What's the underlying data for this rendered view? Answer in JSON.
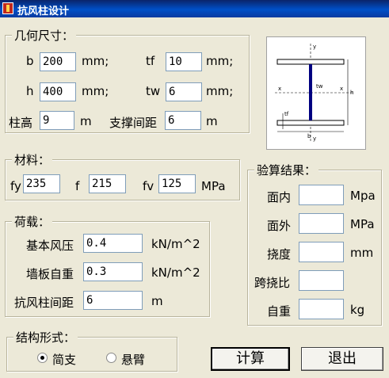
{
  "window": {
    "title": "抗风柱设计"
  },
  "geometry": {
    "legend": "几何尺寸：",
    "b": {
      "label": "b",
      "value": "200",
      "unit": "mm;"
    },
    "h": {
      "label": "h",
      "value": "400",
      "unit": "mm;"
    },
    "tf": {
      "label": "tf",
      "value": "10",
      "unit": "mm;"
    },
    "tw": {
      "label": "tw",
      "value": "6",
      "unit": "mm;"
    },
    "column_height": {
      "label": "柱高",
      "value": "9",
      "unit": "m"
    },
    "brace_spacing": {
      "label": "支撑间距",
      "value": "6",
      "unit": "m"
    }
  },
  "diagram": {
    "labels": {
      "y_top": "y",
      "y_bottom": "y",
      "x_left": "x",
      "x_right": "x",
      "b": "b",
      "h": "h",
      "tw": "tw",
      "tf": "tf"
    },
    "colors": {
      "web": "#000080",
      "flange": "#000000"
    }
  },
  "material": {
    "legend": "材料：",
    "fy": {
      "label": "fy",
      "value": "235"
    },
    "f": {
      "label": "f",
      "value": "215"
    },
    "fv": {
      "label": "fv",
      "value": "125",
      "unit": "MPa"
    }
  },
  "load": {
    "legend": "荷载：",
    "wind_pressure": {
      "label": "基本风压",
      "value": "0.4",
      "unit": "kN/m^2"
    },
    "wall_weight": {
      "label": "墙板自重",
      "value": "0.3",
      "unit": "kN/m^2"
    },
    "column_spacing": {
      "label": "抗风柱间距",
      "value": "6",
      "unit": "m"
    }
  },
  "results": {
    "legend": "验算结果：",
    "in_plane": {
      "label": "面内",
      "unit": "Mpa"
    },
    "out_plane": {
      "label": "面外",
      "unit": "MPa"
    },
    "deflection": {
      "label": "挠度",
      "unit": "mm"
    },
    "deflection_ratio": {
      "label": "跨挠比"
    },
    "self_weight": {
      "label": "自重",
      "unit": "kg"
    }
  },
  "structure": {
    "legend": "结构形式：",
    "options": [
      {
        "label": "简支",
        "checked": true
      },
      {
        "label": "悬臂",
        "checked": false
      }
    ]
  },
  "buttons": {
    "calculate": "计算",
    "exit": "退出"
  }
}
